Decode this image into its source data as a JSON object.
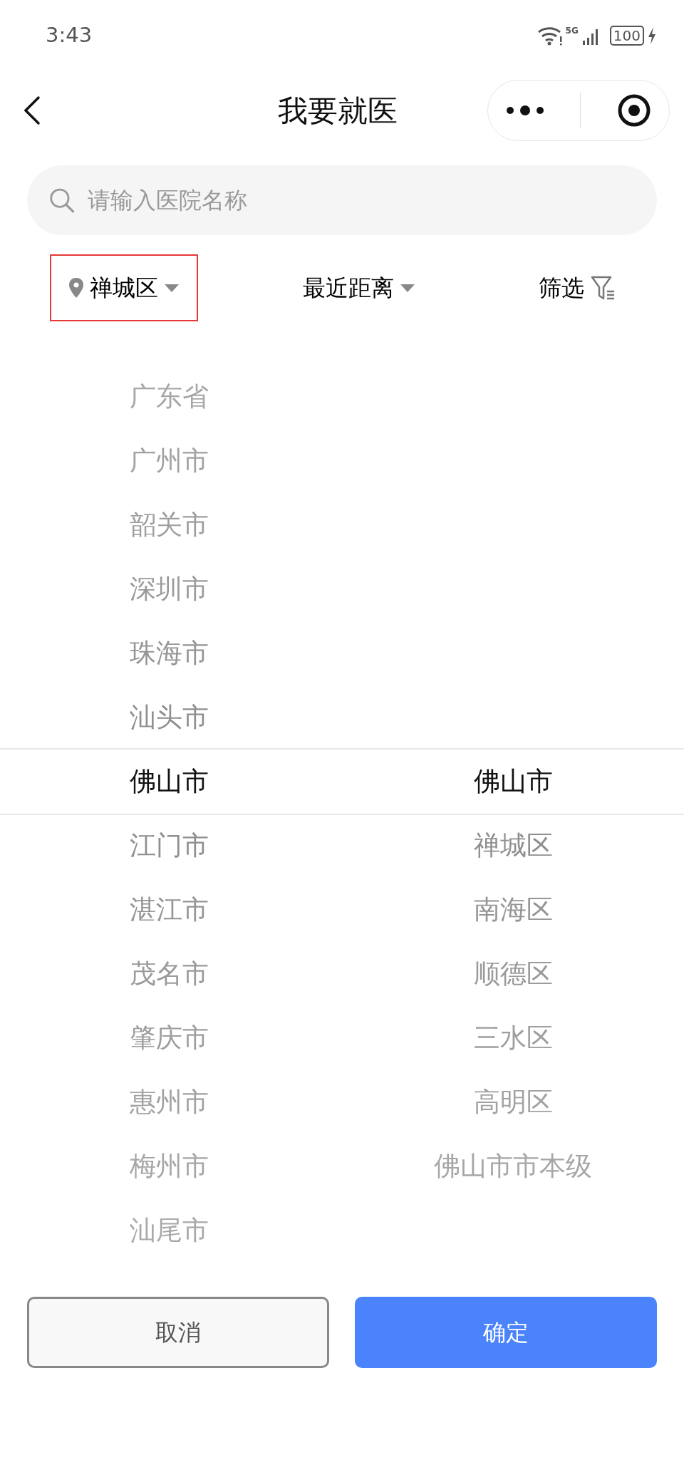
{
  "status_bar": {
    "time": "3:43",
    "network": "5G",
    "battery": "100"
  },
  "header": {
    "title": "我要就医"
  },
  "search": {
    "placeholder": "请输入医院名称"
  },
  "filters": [
    {
      "kind": "location",
      "label": "禅城区",
      "highlighted": true
    },
    {
      "kind": "sort",
      "label": "最近距离",
      "highlighted": false
    },
    {
      "kind": "filter",
      "label": "筛选",
      "highlighted": false
    }
  ],
  "picker": {
    "columns": [
      {
        "items": [
          {
            "label": "广东省",
            "selected": false
          },
          {
            "label": "广州市",
            "selected": false
          },
          {
            "label": "韶关市",
            "selected": false
          },
          {
            "label": "深圳市",
            "selected": false
          },
          {
            "label": "珠海市",
            "selected": false
          },
          {
            "label": "汕头市",
            "selected": false
          },
          {
            "label": "佛山市",
            "selected": true
          },
          {
            "label": "江门市",
            "selected": false
          },
          {
            "label": "湛江市",
            "selected": false
          },
          {
            "label": "茂名市",
            "selected": false
          },
          {
            "label": "肇庆市",
            "selected": false
          },
          {
            "label": "惠州市",
            "selected": false
          },
          {
            "label": "梅州市",
            "selected": false
          },
          {
            "label": "汕尾市",
            "selected": false
          }
        ]
      },
      {
        "items": [
          {
            "label": "佛山市",
            "selected": true
          },
          {
            "label": "禅城区",
            "selected": false
          },
          {
            "label": "南海区",
            "selected": false
          },
          {
            "label": "顺德区",
            "selected": false
          },
          {
            "label": "三水区",
            "selected": false
          },
          {
            "label": "高明区",
            "selected": false
          },
          {
            "label": "佛山市市本级",
            "selected": false
          }
        ]
      }
    ]
  },
  "buttons": [
    {
      "kind": "cancel",
      "label": "取消"
    },
    {
      "kind": "confirm",
      "label": "确定"
    }
  ]
}
